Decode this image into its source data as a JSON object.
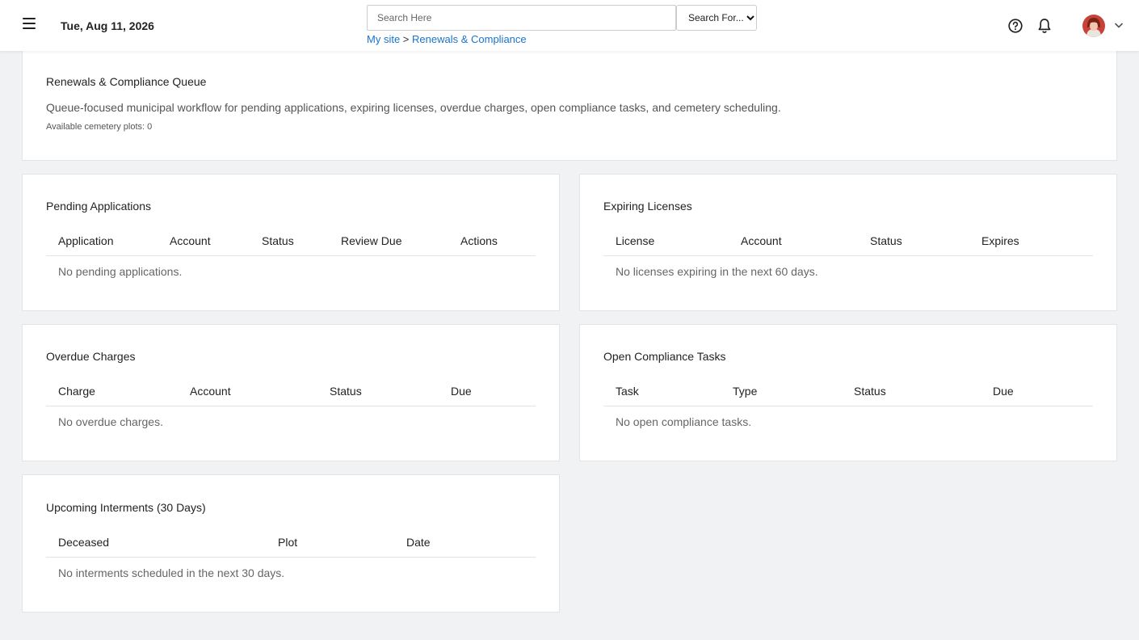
{
  "header": {
    "date": "Tue, Aug 11, 2026",
    "search_placeholder": "Search Here",
    "search_select": "Search For...",
    "breadcrumb": {
      "home": "My site",
      "separator": ">",
      "current": "Renewals & Compliance"
    }
  },
  "intro": {
    "title": "Renewals & Compliance Queue",
    "description": "Queue-focused municipal workflow for pending applications, expiring licenses, overdue charges, open compliance tasks, and cemetery scheduling.",
    "plots": "Available cemetery plots: 0"
  },
  "pending": {
    "title": "Pending Applications",
    "columns": [
      "Application",
      "Account",
      "Status",
      "Review Due",
      "Actions"
    ],
    "empty": "No pending applications."
  },
  "expiring": {
    "title": "Expiring Licenses",
    "columns": [
      "License",
      "Account",
      "Status",
      "Expires"
    ],
    "empty": "No licenses expiring in the next 60 days."
  },
  "overdue": {
    "title": "Overdue Charges",
    "columns": [
      "Charge",
      "Account",
      "Status",
      "Due"
    ],
    "empty": "No overdue charges."
  },
  "tasks": {
    "title": "Open Compliance Tasks",
    "columns": [
      "Task",
      "Type",
      "Status",
      "Due"
    ],
    "empty": "No open compliance tasks."
  },
  "interments": {
    "title": "Upcoming Interments (30 Days)",
    "columns": [
      "Deceased",
      "Plot",
      "Date"
    ],
    "empty": "No interments scheduled in the next 30 days."
  },
  "colors": {
    "link": "#1a73c9",
    "background": "#f1f2f3",
    "card": "#ffffff"
  },
  "icons": {
    "menu": "hamburger-icon",
    "help": "help-circle-icon",
    "notifications": "bell-icon",
    "profile": "avatar",
    "dropdown": "chevron-down-icon"
  }
}
